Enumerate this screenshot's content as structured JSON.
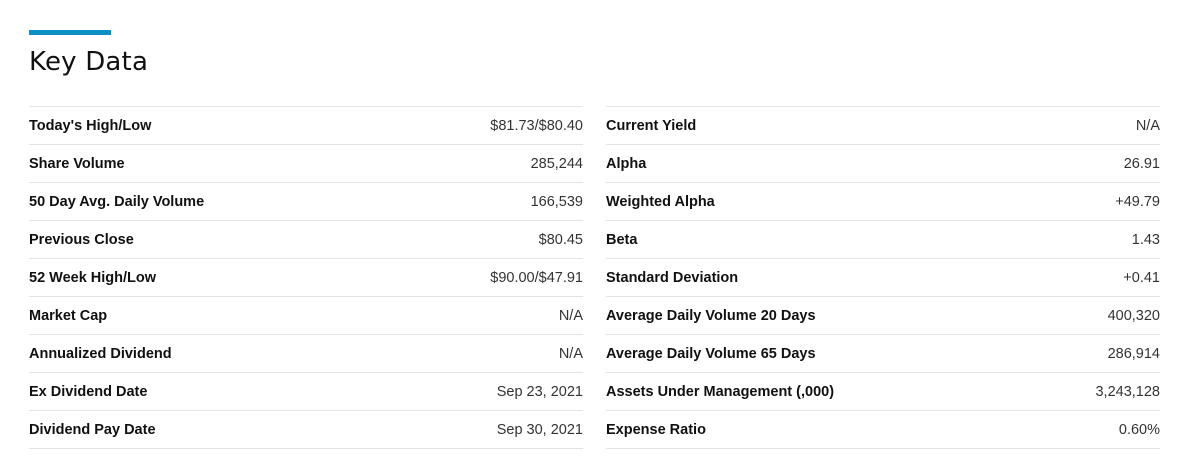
{
  "title": "Key Data",
  "accent_color": "#0b8fc4",
  "left_rows": [
    {
      "label": "Today's High/Low",
      "value": "$81.73/$80.40"
    },
    {
      "label": "Share Volume",
      "value": "285,244"
    },
    {
      "label": "50 Day Avg. Daily Volume",
      "value": "166,539"
    },
    {
      "label": "Previous Close",
      "value": "$80.45"
    },
    {
      "label": "52 Week High/Low",
      "value": "$90.00/$47.91"
    },
    {
      "label": "Market Cap",
      "value": "N/A"
    },
    {
      "label": "Annualized Dividend",
      "value": "N/A"
    },
    {
      "label": "Ex Dividend Date",
      "value": "Sep 23, 2021"
    },
    {
      "label": "Dividend Pay Date",
      "value": "Sep 30, 2021"
    }
  ],
  "right_rows": [
    {
      "label": "Current Yield",
      "value": "N/A"
    },
    {
      "label": "Alpha",
      "value": "26.91"
    },
    {
      "label": "Weighted Alpha",
      "value": "+49.79"
    },
    {
      "label": "Beta",
      "value": "1.43"
    },
    {
      "label": "Standard Deviation",
      "value": "+0.41"
    },
    {
      "label": "Average Daily Volume 20 Days",
      "value": "400,320"
    },
    {
      "label": "Average Daily Volume 65 Days",
      "value": "286,914"
    },
    {
      "label": "Assets Under Management (,000)",
      "value": "3,243,128"
    },
    {
      "label": "Expense Ratio",
      "value": "0.60%"
    }
  ]
}
